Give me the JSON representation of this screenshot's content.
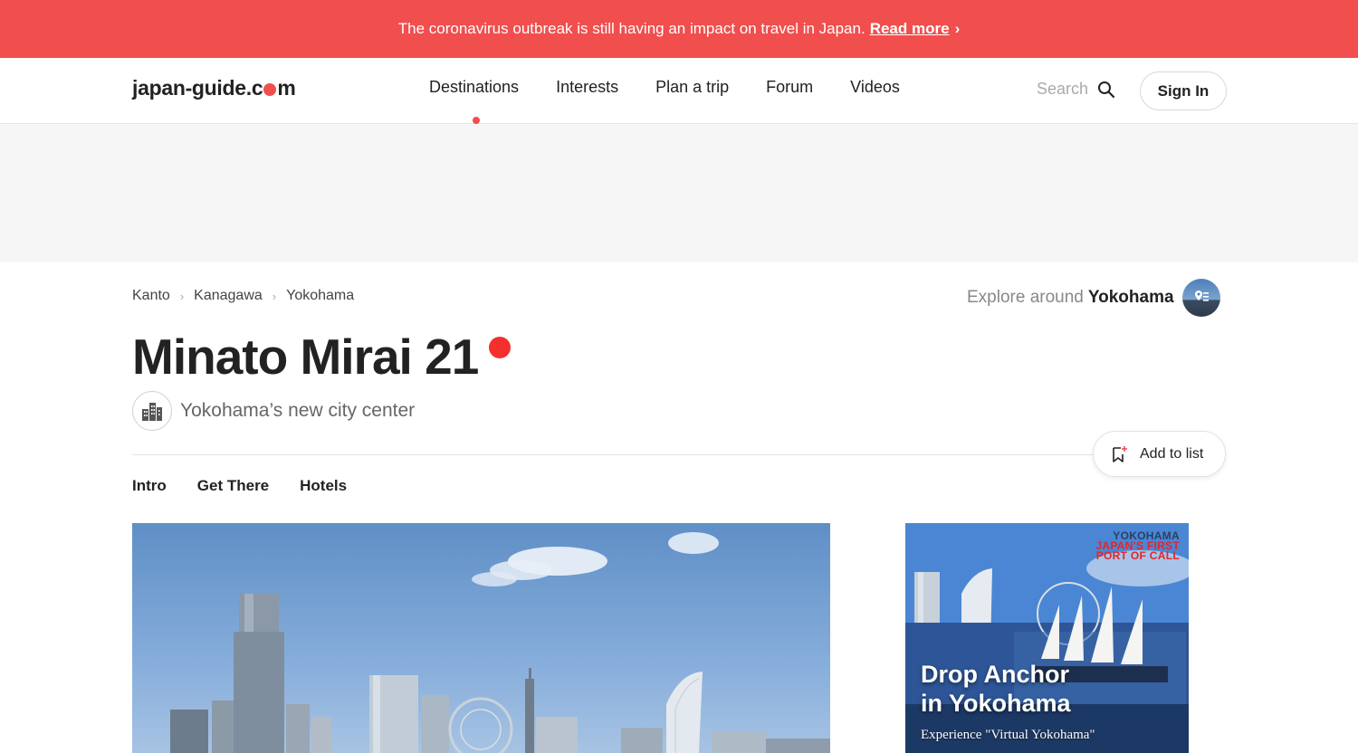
{
  "alert": {
    "message": "The coronavirus outbreak is still having an impact on travel in Japan.",
    "link_label": "Read more",
    "chevron": "›"
  },
  "header": {
    "logo_left": "japan-guide.c",
    "logo_right": "m",
    "nav": [
      "Destinations",
      "Interests",
      "Plan a trip",
      "Forum",
      "Videos"
    ],
    "active_nav": "Destinations",
    "search_placeholder": "Search",
    "signin_label": "Sign In"
  },
  "breadcrumb": [
    "Kanto",
    "Kanagawa",
    "Yokohama"
  ],
  "explore": {
    "prefix": "Explore around",
    "place": "Yokohama"
  },
  "page": {
    "title": "Minato Mirai 21",
    "subtitle": "Yokohama’s new city center",
    "category_icon": "city-buildings-icon",
    "add_to_list_label": "Add to list"
  },
  "tabs": [
    "Intro",
    "Get There",
    "Hotels"
  ],
  "side_ad": {
    "brand_line1": "YOKOHAMA",
    "brand_line2": "JAPAN'S FIRST",
    "brand_line3": "PORT OF CALL",
    "headline1": "Drop Anchor",
    "headline2": "in Yokohama",
    "subline": "Experience \"Virtual Yokohama\""
  },
  "colors": {
    "accent": "#f14e4e",
    "title_dot": "#f5302c",
    "text": "#222222",
    "muted": "#888888"
  }
}
